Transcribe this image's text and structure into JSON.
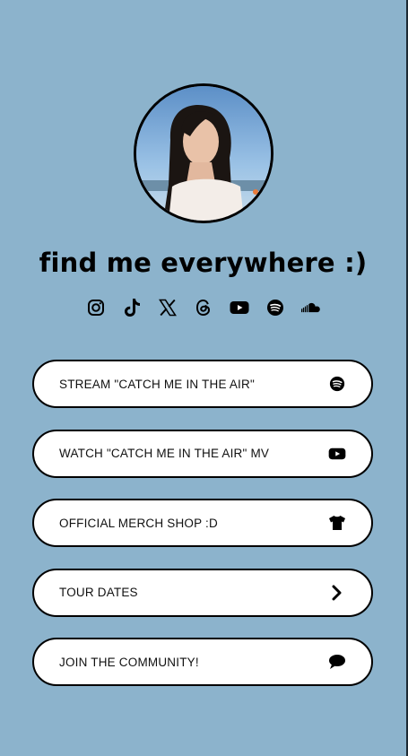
{
  "profile": {
    "headline": "find me everywhere :)"
  },
  "socials": [
    {
      "icon": "instagram-icon"
    },
    {
      "icon": "tiktok-icon"
    },
    {
      "icon": "x-icon"
    },
    {
      "icon": "threads-icon"
    },
    {
      "icon": "youtube-icon"
    },
    {
      "icon": "spotify-icon"
    },
    {
      "icon": "soundcloud-icon"
    }
  ],
  "links": [
    {
      "label": "STREAM \"CATCH ME IN THE AIR\"",
      "icon": "spotify-icon"
    },
    {
      "label": "WATCH \"CATCH ME IN THE AIR\" MV",
      "icon": "youtube-icon"
    },
    {
      "label": "OFFICIAL MERCH SHOP :D",
      "icon": "tshirt-icon"
    },
    {
      "label": "TOUR DATES",
      "icon": "chevron-right-icon"
    },
    {
      "label": "JOIN THE COMMUNITY!",
      "icon": "chat-bubble-icon"
    }
  ],
  "colors": {
    "background": "#8cb3cc",
    "button_bg": "#ffffff",
    "border": "#000000"
  }
}
